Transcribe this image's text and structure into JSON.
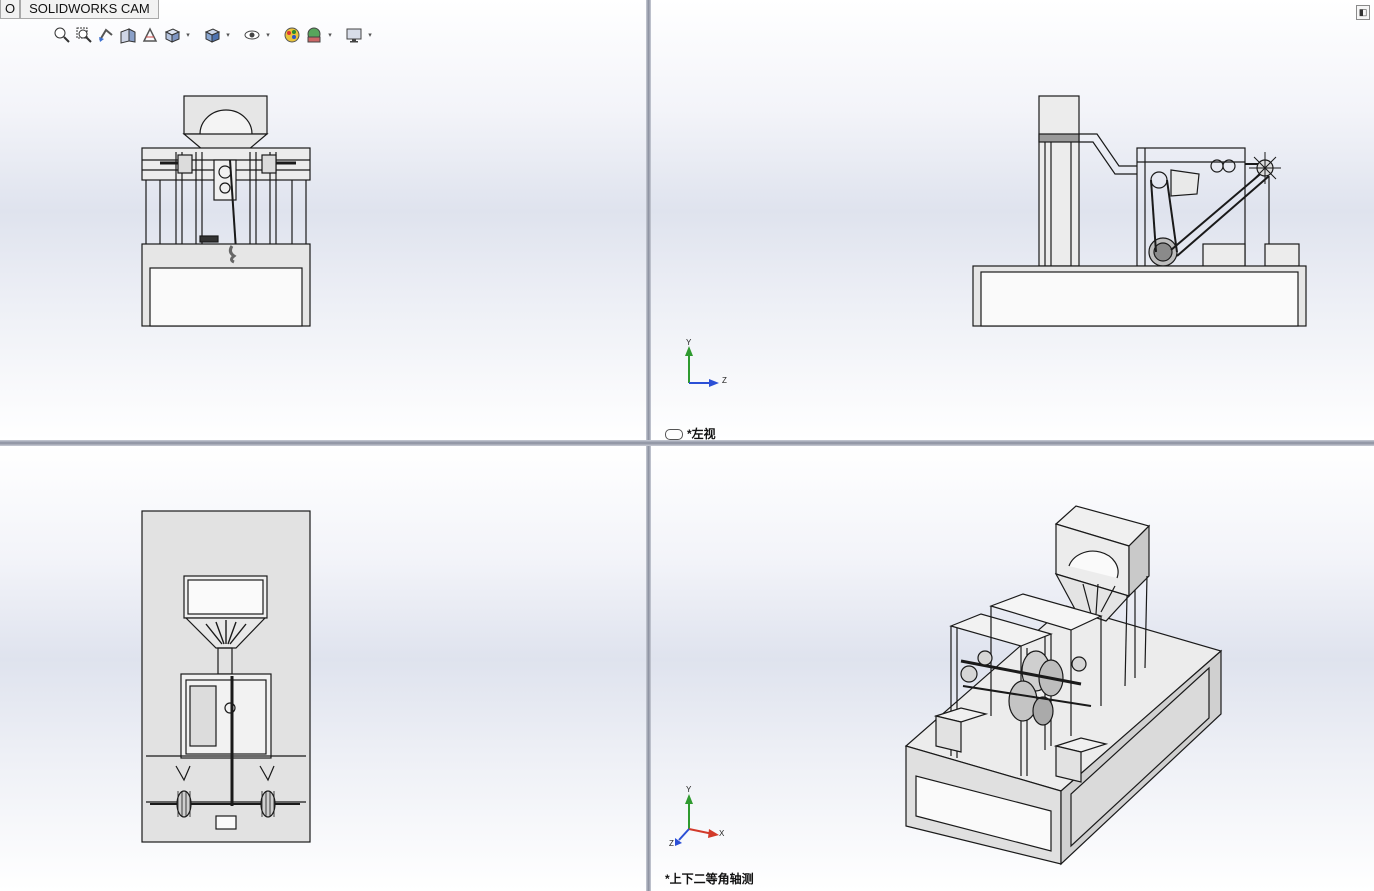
{
  "tabs": [
    "O",
    "SOLIDWORKS CAM"
  ],
  "toolbar": {
    "icons": [
      "zoom-to-fit-icon",
      "zoom-area-icon",
      "previous-view-icon",
      "section-view-icon",
      "dynamic-annotation-icon",
      "view-orientation-icon",
      "display-style-icon",
      "hide-show-items-icon",
      "edit-appearance-icon",
      "apply-scene-icon",
      "view-settings-icon"
    ]
  },
  "views": {
    "front": {
      "label": ""
    },
    "left": {
      "label": "*左视"
    },
    "top": {
      "label": ""
    },
    "iso": {
      "label": "*上下二等角轴测"
    }
  },
  "triad": {
    "y": "Y",
    "z": "Z",
    "x": "X"
  },
  "colors": {
    "accent_green": "#2f9a2f",
    "accent_blue": "#2b4fd6",
    "accent_red": "#d23a2a",
    "model_fill": "#e6e6e6",
    "model_edge": "#1a1a1a"
  }
}
